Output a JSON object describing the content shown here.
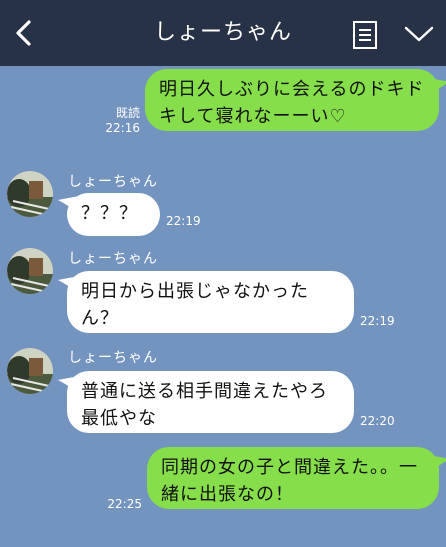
{
  "header": {
    "title": "しょーちゃん",
    "back_icon": "chevron-left-icon",
    "notes_icon": "notes-icon",
    "menu_icon": "chevron-down-icon",
    "bg_color": "#273246"
  },
  "chat": {
    "bg_color": "#7494c0",
    "outgoing_bubble_color": "#86de4b",
    "incoming_bubble_color": "#ffffff",
    "messages": [
      {
        "direction": "out",
        "text": "明日久しぶりに会えるのドキドキして寝れなーーい♡",
        "read_label": "既読",
        "time": "22:16"
      },
      {
        "direction": "in",
        "sender": "しょーちゃん",
        "text": "？？？",
        "time": "22:19"
      },
      {
        "direction": "in",
        "sender": "しょーちゃん",
        "text": "明日から出張じゃなかったん？",
        "time": "22:19"
      },
      {
        "direction": "in",
        "sender": "しょーちゃん",
        "text": "普通に送る相手間違えたやろ最低やな",
        "time": "22:20"
      },
      {
        "direction": "out",
        "text": "同期の女の子と間違えた。。一緒に出張なの！",
        "time": "22:25"
      }
    ]
  }
}
